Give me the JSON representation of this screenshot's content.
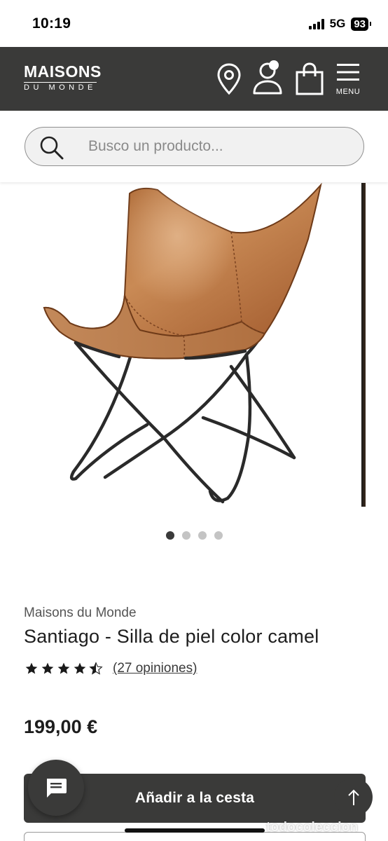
{
  "status_bar": {
    "time": "10:19",
    "network": "5G",
    "battery": "93"
  },
  "header": {
    "logo_main": "MAISONS",
    "logo_sub": "DU MONDE",
    "menu_label": "MENU",
    "icons": [
      "location-pin-icon",
      "user-account-icon",
      "shopping-bag-icon",
      "hamburger-menu-icon"
    ]
  },
  "search": {
    "placeholder": "Busco un producto..."
  },
  "gallery": {
    "slide_count": 4,
    "active_slide": 1,
    "image": "leather butterfly chair"
  },
  "product": {
    "brand": "Maisons du Monde",
    "title": "Santiago - Silla de piel color camel",
    "rating": 4.5,
    "rating_max": 5,
    "reviews_label": "(27 opiniones)",
    "price": "199,00 €"
  },
  "actions": {
    "add_to_cart": "Añadir a la cesta"
  },
  "watermark": "todocoleccion",
  "colors": {
    "header_bg": "#3a3a39",
    "button_bg": "#3a3a39",
    "leather": "#b06a37"
  }
}
